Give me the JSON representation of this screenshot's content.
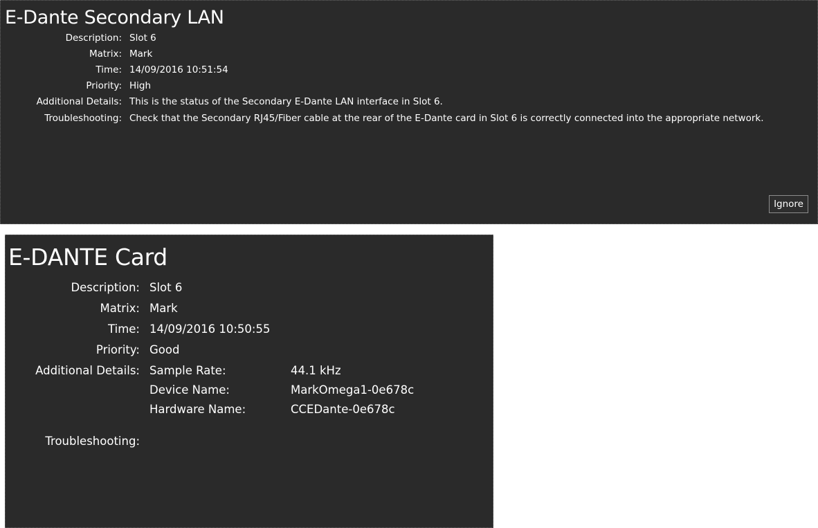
{
  "alerts": [
    {
      "title": "E-Dante Secondary LAN",
      "fields": {
        "description": {
          "label": "Description:",
          "value": "Slot 6"
        },
        "matrix": {
          "label": "Matrix:",
          "value": "Mark"
        },
        "time": {
          "label": "Time:",
          "value": "14/09/2016 10:51:54"
        },
        "priority": {
          "label": "Priority:",
          "value": "High"
        },
        "additional_details": {
          "label": "Additional Details:",
          "value": "This is the status of the Secondary E-Dante LAN interface in Slot 6."
        },
        "troubleshooting": {
          "label": "Troubleshooting:",
          "value": "Check that the Secondary RJ45/Fiber cable at the rear of the E-Dante card in Slot 6 is correctly connected into the appropriate network."
        }
      },
      "ignore_button": "Ignore"
    },
    {
      "title": "E-DANTE Card",
      "fields": {
        "description": {
          "label": "Description:",
          "value": "Slot 6"
        },
        "matrix": {
          "label": "Matrix:",
          "value": "Mark"
        },
        "time": {
          "label": "Time:",
          "value": "14/09/2016 10:50:55"
        },
        "priority": {
          "label": "Priority:",
          "value": "Good"
        },
        "additional_details": {
          "label": "Additional Details:",
          "items": [
            {
              "key": "Sample Rate:",
              "value": "44.1 kHz"
            },
            {
              "key": "Device Name:",
              "value": "MarkOmega1-0e678c"
            },
            {
              "key": "Hardware Name:",
              "value": "CCEDante-0e678c"
            }
          ]
        },
        "troubleshooting": {
          "label": "Troubleshooting:",
          "value": ""
        }
      }
    }
  ],
  "colors": {
    "panel_background": "#2a2a2a",
    "text": "#ffffff",
    "page_background": "#ffffff"
  }
}
